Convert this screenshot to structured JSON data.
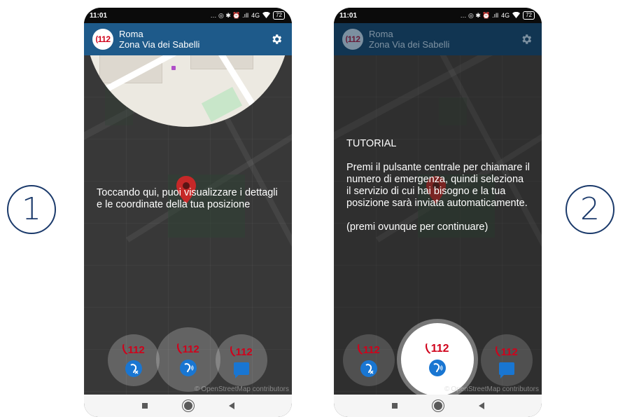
{
  "steps": [
    "1",
    "2"
  ],
  "colors": {
    "brand_blue": "#1e5a8a",
    "emergency_red": "#d0021b",
    "step_circle": "#1b3a6b",
    "icon_blue": "#1976d2"
  },
  "status": {
    "time": "11:01",
    "network": "4G",
    "battery": "72",
    "icons_text": "… ◎ ✱ ⏰ .ıll"
  },
  "header": {
    "logo_text": "112",
    "city": "Roma",
    "zone": "Zona Via dei Sabelli",
    "icons": [
      "emergency-logo",
      "gear-icon"
    ]
  },
  "screen1": {
    "hint": "Toccando qui, puoi visualizzare i dettagli e le coordinate della tua posizione"
  },
  "screen2": {
    "title": "TUTORIAL",
    "body": "Premi il pulsante centrale per chiamare il numero di emergenza, quindi seleziona il servizio di cui hai bisogno e la tua posizione sarà inviata automaticamente.",
    "continue": "(premi ovunque per continuare)"
  },
  "buttons": {
    "left_label": "112",
    "center_label": "112",
    "right_label": "112",
    "icons": [
      "deaf-icon",
      "deaf-speech-icon",
      "chat-icon"
    ]
  },
  "attribution": "OpenStreetMap contributors",
  "attribution_symbol": "©"
}
